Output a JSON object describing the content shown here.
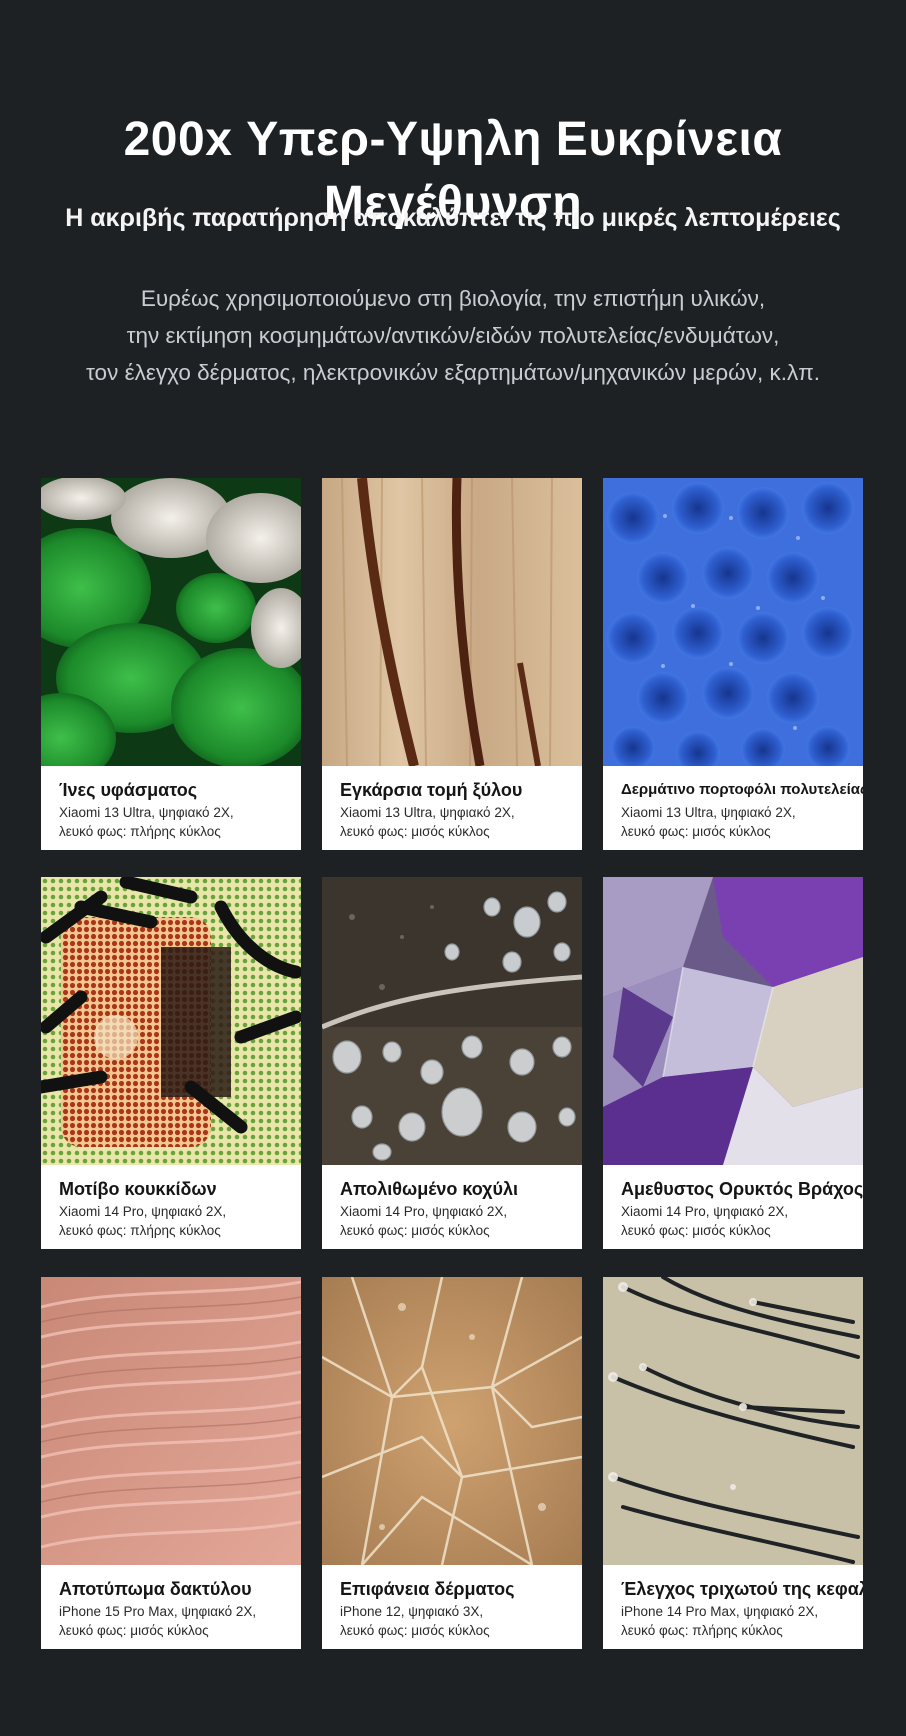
{
  "header": {
    "title": "200x Υπερ-Υψηλη Ευκρίνεια Μεγέθυνση",
    "subtitle": "Η ακριβής παρατήρηση αποκαλύπτει τις πιο μικρές λεπτομέρειες",
    "description_lines": [
      "Ευρέως χρησιμοποιούμενο στη βιολογία, την επιστήμη υλικών,",
      "την εκτίμηση κοσμημάτων/αντικών/ειδών πολυτελείας/ενδυμάτων,",
      "τον έλεγχο δέρματος, ηλεκτρονικών εξαρτημάτων/μηχανικών μερών, κ.λπ."
    ]
  },
  "cards": [
    {
      "title": "Ίνες υφάσματος",
      "device": "Xiaomi 13 Ultra, ψηφιακό 2X,",
      "light": "λευκό φως: πλήρης κύκλος",
      "image": "green-white-fabric-fibers"
    },
    {
      "title": "Εγκάρσια τομή ξύλου",
      "device": "Xiaomi 13 Ultra, ψηφιακό 2X,",
      "light": "λευκό φως: μισός κύκλος",
      "image": "wood-cross-section"
    },
    {
      "title": "Δερμάτινο πορτοφόλι πολυτελείας",
      "device": "Xiaomi 13 Ultra, ψηφιακό 2X,",
      "light": "λευκό φως: μισός κύκλος",
      "image": "blue-leather-texture"
    },
    {
      "title": "Μοτίβο κουκκίδων",
      "device": "Xiaomi 14 Pro, ψηφιακό 2X,",
      "light": "λευκό φως: πλήρης κύκλος",
      "image": "halftone-dot-pattern"
    },
    {
      "title": "Απολιθωμένο κοχύλι",
      "device": "Xiaomi 14 Pro, ψηφιακό 2X,",
      "light": "λευκό φως: μισός κύκλος",
      "image": "fossil-shell-crystals"
    },
    {
      "title": "Αμεθυστος Ορυκτός Βράχος",
      "device": "Xiaomi 14 Pro, ψηφιακό 2X,",
      "light": "λευκό φως: μισός κύκλος",
      "image": "amethyst-crystal"
    },
    {
      "title": "Αποτύπωμα δακτύλου",
      "device": "iPhone 15 Pro Max, ψηφιακό 2X,",
      "light": "λευκό φως: μισός κύκλος",
      "image": "fingerprint-ridges"
    },
    {
      "title": "Επιφάνεια δέρματος",
      "device": "iPhone 12, ψηφιακό 3X,",
      "light": "λευκό φως: μισός κύκλος",
      "image": "skin-surface"
    },
    {
      "title": "Έλεγχος τριχωτού της κεφαλής",
      "device": "iPhone 14 Pro Max, ψηφιακό 2X,",
      "light": "λευκό φως: πλήρης κύκλος",
      "image": "scalp-hair-follicles"
    }
  ],
  "colors": {
    "background": "#1e2124",
    "caption_bg": "#ffffff",
    "title_text": "#ffffff",
    "description_text": "#c9ccd0"
  }
}
